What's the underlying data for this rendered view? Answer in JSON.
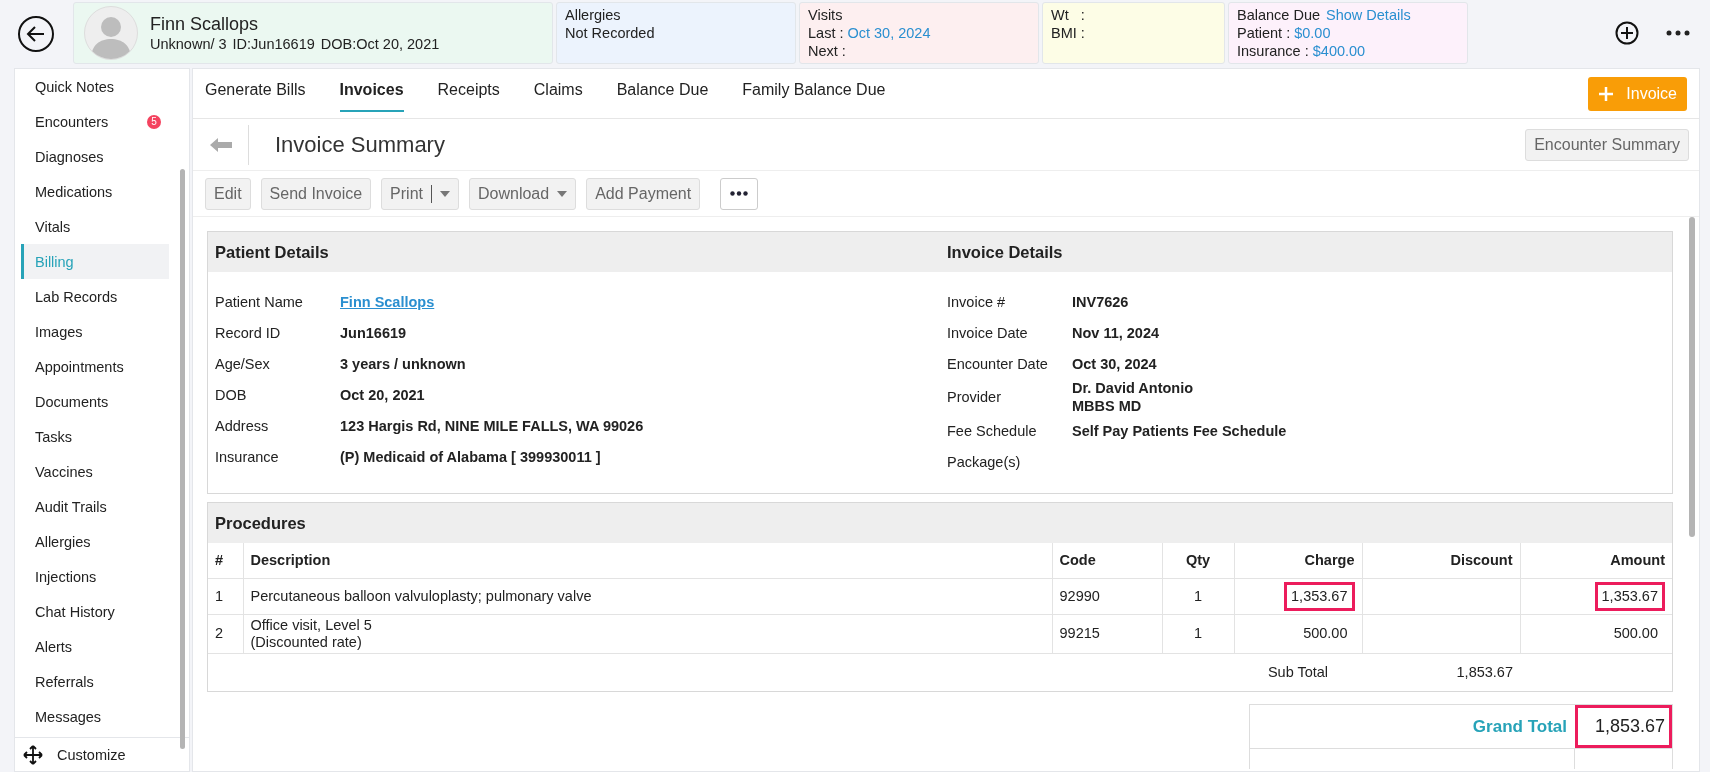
{
  "header": {
    "patient": {
      "name": "Finn Scallops",
      "sex_age": "Unknown/ 3",
      "id": "ID:Jun16619",
      "dob": "DOB:Oct 20, 2021"
    },
    "allergies": {
      "title": "Allergies",
      "value": "Not Recorded"
    },
    "visits": {
      "title": "Visits",
      "last_label": "Last :",
      "last_value": "Oct 30, 2024",
      "next_label": "Next :"
    },
    "vitals": {
      "wt_label": "Wt   :",
      "bmi_label": "BMI :"
    },
    "balance": {
      "title": "Balance Due",
      "link": "Show Details",
      "patient_label": "Patient :",
      "patient_value": "$0.00",
      "insurance_label": "Insurance :",
      "insurance_value": "$400.00"
    }
  },
  "sidebar": {
    "items": [
      {
        "label": "Quick Notes",
        "selected": false
      },
      {
        "label": "Encounters",
        "selected": false,
        "badge": "5"
      },
      {
        "label": "Diagnoses",
        "selected": false
      },
      {
        "label": "Medications",
        "selected": false
      },
      {
        "label": "Vitals",
        "selected": false
      },
      {
        "label": "Billing",
        "selected": true
      },
      {
        "label": "Lab Records",
        "selected": false
      },
      {
        "label": "Images",
        "selected": false
      },
      {
        "label": "Appointments",
        "selected": false
      },
      {
        "label": "Documents",
        "selected": false
      },
      {
        "label": "Tasks",
        "selected": false
      },
      {
        "label": "Vaccines",
        "selected": false
      },
      {
        "label": "Audit Trails",
        "selected": false
      },
      {
        "label": "Allergies",
        "selected": false
      },
      {
        "label": "Injections",
        "selected": false
      },
      {
        "label": "Chat History",
        "selected": false
      },
      {
        "label": "Alerts",
        "selected": false
      },
      {
        "label": "Referrals",
        "selected": false
      },
      {
        "label": "Messages",
        "selected": false
      }
    ],
    "customize": "Customize"
  },
  "tabs": [
    {
      "label": "Generate Bills",
      "selected": false
    },
    {
      "label": "Invoices",
      "selected": true
    },
    {
      "label": "Receipts",
      "selected": false
    },
    {
      "label": "Claims",
      "selected": false
    },
    {
      "label": "Balance Due",
      "selected": false
    },
    {
      "label": "Family Balance Due",
      "selected": false
    }
  ],
  "new_invoice_button": "Invoice",
  "page_title": "Invoice Summary",
  "encounter_summary_button": "Encounter Summary",
  "actions": [
    {
      "label": "Edit",
      "kind": "plain"
    },
    {
      "label": "Send Invoice",
      "kind": "plain"
    },
    {
      "label": "Print",
      "kind": "split"
    },
    {
      "label": "Download",
      "kind": "dropdown"
    },
    {
      "label": "Add Payment",
      "kind": "plain"
    }
  ],
  "patient_details": {
    "title": "Patient Details",
    "rows": [
      {
        "label": "Patient Name",
        "value": "Finn Scallops",
        "kind": "link"
      },
      {
        "label": "Record ID",
        "value": "Jun16619",
        "kind": "text"
      },
      {
        "label": "Age/Sex",
        "value": "3 years / unknown",
        "kind": "text"
      },
      {
        "label": "DOB",
        "value": "Oct 20, 2021",
        "kind": "text"
      },
      {
        "label": "Address",
        "value": "123 Hargis Rd, NINE MILE FALLS, WA 99026",
        "kind": "text"
      },
      {
        "label": "Insurance",
        "value": "(P) Medicaid of Alabama [ 399930011 ]",
        "kind": "text"
      }
    ]
  },
  "invoice_details": {
    "title": "Invoice Details",
    "rows": [
      {
        "label": "Invoice #",
        "value": "INV7626",
        "kind": "text"
      },
      {
        "label": "Invoice Date",
        "value": "Nov 11, 2024",
        "kind": "text"
      },
      {
        "label": "Encounter Date",
        "value": "Oct 30, 2024",
        "kind": "text"
      },
      {
        "label": "Provider",
        "value": "Dr. David Antonio\nMBBS MD",
        "kind": "text"
      },
      {
        "label": "Fee Schedule",
        "value": "Self Pay Patients Fee Schedule",
        "kind": "text"
      },
      {
        "label": "Package(s)"
      }
    ]
  },
  "procedures": {
    "title": "Procedures",
    "columns": [
      "#",
      "Description",
      "Code",
      "Qty",
      "Charge",
      "Discount",
      "Amount"
    ],
    "rows": [
      {
        "number": "1",
        "description": "Percutaneous balloon valvuloplasty; pulmonary valve",
        "code": "92990",
        "qty": "1",
        "charge": {
          "text": "1,353.67",
          "highlighted": true
        },
        "amount": {
          "text": "1,353.67",
          "highlighted": true
        }
      },
      {
        "number": "2",
        "description": "Office visit, Level 5\n(Discounted rate)",
        "code": "99215",
        "qty": "1",
        "charge": {
          "text": "500.00",
          "highlighted": false
        },
        "amount": {
          "text": "500.00",
          "highlighted": false
        }
      }
    ],
    "subtotal_label": "Sub Total",
    "subtotal_value": "1,853.67",
    "grand_total_label": "Grand Total",
    "grand_total": {
      "text": "1,853.67",
      "highlighted": true
    }
  }
}
